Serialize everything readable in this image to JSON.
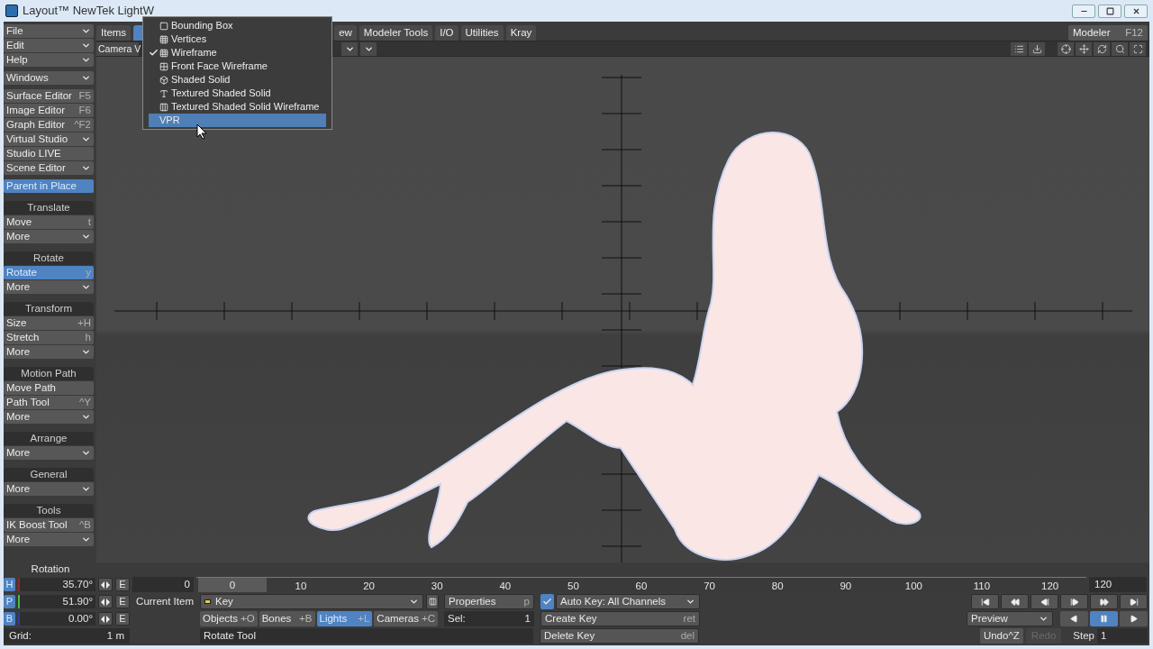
{
  "window": {
    "title": "Layout™ NewTek LightW"
  },
  "sidebar": {
    "groups": [
      {
        "items": [
          {
            "label": "File",
            "kind": "menu",
            "selected": false
          },
          {
            "label": "Edit",
            "kind": "menu",
            "selected": false
          },
          {
            "label": "Help",
            "kind": "menu",
            "selected": false
          }
        ]
      },
      {
        "items": [
          {
            "label": "Windows",
            "kind": "menu",
            "selected": false
          }
        ]
      },
      {
        "items": [
          {
            "label": "Surface Editor",
            "shortcut": "F5",
            "kind": "button",
            "selected": false
          },
          {
            "label": "Image Editor",
            "shortcut": "F6",
            "kind": "button",
            "selected": false
          },
          {
            "label": "Graph Editor",
            "shortcut": "^F2",
            "kind": "button",
            "selected": false
          },
          {
            "label": "Virtual Studio",
            "kind": "menu",
            "selected": false
          },
          {
            "label": "Studio LIVE",
            "kind": "button",
            "selected": false
          },
          {
            "label": "Scene Editor",
            "kind": "menu",
            "selected": false
          }
        ]
      },
      {
        "items": [
          {
            "label": "Parent in Place",
            "kind": "button",
            "selected": true
          }
        ]
      },
      {
        "title": "Translate",
        "items": [
          {
            "label": "Move",
            "shortcut": "t",
            "kind": "button",
            "selected": false
          },
          {
            "label": "More",
            "kind": "menu",
            "selected": false
          }
        ]
      },
      {
        "title": "Rotate",
        "items": [
          {
            "label": "Rotate",
            "shortcut": "y",
            "kind": "button",
            "selected": true
          },
          {
            "label": "More",
            "kind": "menu",
            "selected": false
          }
        ]
      },
      {
        "title": "Transform",
        "items": [
          {
            "label": "Size",
            "shortcut": "+H",
            "kind": "button",
            "selected": false
          },
          {
            "label": "Stretch",
            "shortcut": "h",
            "kind": "button",
            "selected": false
          },
          {
            "label": "More",
            "kind": "menu",
            "selected": false
          }
        ]
      },
      {
        "title": "Motion Path",
        "items": [
          {
            "label": "Move Path",
            "kind": "button",
            "selected": false
          },
          {
            "label": "Path Tool",
            "shortcut": "^Y",
            "kind": "button",
            "selected": false
          },
          {
            "label": "More",
            "kind": "menu",
            "selected": false
          }
        ]
      },
      {
        "title": "Arrange",
        "items": [
          {
            "label": "More",
            "kind": "menu",
            "selected": false
          }
        ]
      },
      {
        "title": "General",
        "items": [
          {
            "label": "More",
            "kind": "menu",
            "selected": false
          }
        ]
      },
      {
        "title": "Tools",
        "items": [
          {
            "label": "IK Boost Tool",
            "shortcut": "^B",
            "kind": "button",
            "selected": false
          },
          {
            "label": "More",
            "kind": "menu",
            "selected": false
          }
        ]
      }
    ]
  },
  "tabs": [
    {
      "label": "Items",
      "selected": false
    },
    {
      "selected": true
    },
    {
      "label": "ew",
      "selected": false
    },
    {
      "label": "Modeler Tools",
      "selected": false
    },
    {
      "label": "I/O",
      "selected": false
    },
    {
      "label": "Utilities",
      "selected": false
    },
    {
      "label": "Kray",
      "selected": false
    }
  ],
  "modeler_button": {
    "label": "Modeler",
    "shortcut": "F12"
  },
  "view_selector": {
    "label": "Camera V"
  },
  "display_menu": {
    "items": [
      {
        "label": "Bounding Box",
        "checked": false,
        "selected": false
      },
      {
        "label": "Vertices",
        "checked": false,
        "selected": false
      },
      {
        "label": "Wireframe",
        "checked": true,
        "selected": false
      },
      {
        "label": "Front Face Wireframe",
        "checked": false,
        "selected": false
      },
      {
        "label": "Shaded Solid",
        "checked": false,
        "selected": false
      },
      {
        "label": "Textured Shaded Solid",
        "checked": false,
        "selected": false
      },
      {
        "label": "Textured Shaded Solid Wireframe",
        "checked": false,
        "selected": false
      },
      {
        "label": "VPR",
        "checked": false,
        "selected": true
      }
    ]
  },
  "rotation": {
    "title": "Rotation",
    "channels": [
      {
        "axis": "H",
        "value": "35.70°",
        "envelope": "E",
        "color": "#8a2a2a"
      },
      {
        "axis": "P",
        "value": "51.90°",
        "envelope": "E",
        "color": "#3fbf3f"
      },
      {
        "axis": "B",
        "value": "0.00°",
        "envelope": "E",
        "color": "#2a3f9a"
      }
    ]
  },
  "grid": {
    "label": "Grid:",
    "value": "1 m"
  },
  "timeline": {
    "start_field": "0",
    "current_frame": "0",
    "ticks": [
      "10",
      "20",
      "30",
      "40",
      "50",
      "60",
      "70",
      "80",
      "90",
      "100",
      "110",
      "120"
    ],
    "end_field": "120"
  },
  "current_item": {
    "label": "Current Item",
    "value": "Key"
  },
  "properties": {
    "label": "Properties",
    "shortcut": "p"
  },
  "item_types": [
    {
      "label": "Objects",
      "shortcut": "+O",
      "selected": false
    },
    {
      "label": "Bones",
      "shortcut": "+B",
      "selected": false
    },
    {
      "label": "Lights",
      "shortcut": "+L",
      "selected": true
    },
    {
      "label": "Cameras",
      "shortcut": "+C",
      "selected": false
    }
  ],
  "selection": {
    "label": "Sel:",
    "value": "1"
  },
  "status": "Rotate Tool",
  "auto_key": {
    "label": "Auto Key: All Channels",
    "checked": true
  },
  "create_key": {
    "label": "Create Key",
    "shortcut": "ret"
  },
  "delete_key": {
    "label": "Delete Key",
    "shortcut": "del"
  },
  "playback": {
    "mode": "Preview",
    "buttons": [
      {
        "selected": false
      },
      {
        "selected": true
      },
      {
        "selected": false
      }
    ]
  },
  "undo": {
    "label": "Undo",
    "shortcut": "^Z",
    "disabled": false
  },
  "redo": {
    "label": "Redo",
    "disabled": true
  },
  "step": {
    "label": "Step",
    "value": "1"
  }
}
